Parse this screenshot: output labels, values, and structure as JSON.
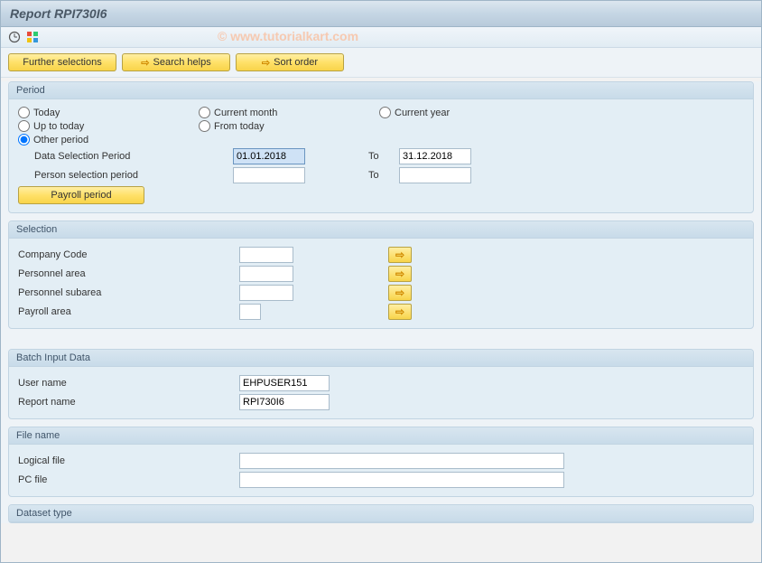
{
  "header": {
    "title": "Report RPI730I6",
    "watermark": "© www.tutorialkart.com"
  },
  "toolbar": {
    "further_selections": "Further selections",
    "search_helps": "Search helps",
    "sort_order": "Sort order"
  },
  "period": {
    "title": "Period",
    "today": "Today",
    "current_month": "Current month",
    "current_year": "Current year",
    "up_to_today": "Up to today",
    "from_today": "From today",
    "other_period": "Other period",
    "data_selection_label": "Data Selection Period",
    "data_selection_from": "01.01.2018",
    "data_selection_to_label": "To",
    "data_selection_to": "31.12.2018",
    "person_selection_label": "Person selection period",
    "person_selection_from": "",
    "person_selection_to_label": "To",
    "person_selection_to": "",
    "payroll_period_btn": "Payroll period"
  },
  "selection": {
    "title": "Selection",
    "company_code": "Company Code",
    "personnel_area": "Personnel area",
    "personnel_subarea": "Personnel subarea",
    "payroll_area": "Payroll area"
  },
  "batch_input": {
    "title": "Batch Input Data",
    "user_name_label": "User name",
    "user_name_value": "EHPUSER151",
    "report_name_label": "Report name",
    "report_name_value": "RPI730I6"
  },
  "file_name": {
    "title": "File name",
    "logical_file": "Logical file",
    "pc_file": "PC file"
  },
  "dataset_type": {
    "title": "Dataset type"
  }
}
